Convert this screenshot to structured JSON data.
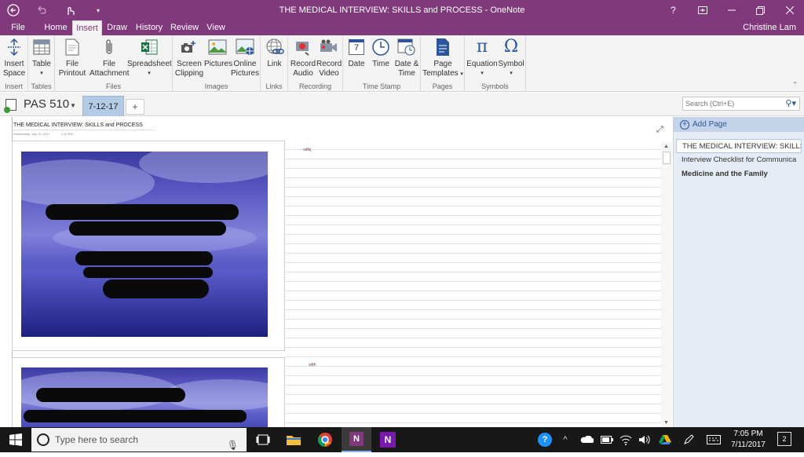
{
  "window": {
    "title": "THE MEDICAL INTERVIEW: SKILLS and PROCESS - OneNote",
    "help": "?",
    "user": "Christine Lam"
  },
  "ribbon_tabs": [
    "File",
    "Home",
    "Insert",
    "Draw",
    "History",
    "Review",
    "View"
  ],
  "active_tab": "Insert",
  "ribbon": {
    "insert_space": [
      "Insert",
      "Space"
    ],
    "table": "Table",
    "file_printout": [
      "File",
      "Printout"
    ],
    "file_attachment": [
      "File",
      "Attachment"
    ],
    "spreadsheet": "Spreadsheet",
    "screen_clipping": [
      "Screen",
      "Clipping"
    ],
    "pictures": "Pictures",
    "online_pictures": [
      "Online",
      "Pictures"
    ],
    "link": "Link",
    "record_audio": [
      "Record",
      "Audio"
    ],
    "record_video": [
      "Record",
      "Video"
    ],
    "date": "Date",
    "time": "Time",
    "date_time": [
      "Date &",
      "Time"
    ],
    "page_templates": [
      "Page",
      "Templates"
    ],
    "equation": "Equation",
    "symbol": "Symbol",
    "date_icon_text": "7",
    "group_labels": {
      "insert": "Insert",
      "tables": "Tables",
      "files": "Files",
      "images": "Images",
      "links": "Links",
      "recording": "Recording",
      "timestamp": "Time Stamp",
      "pages": "Pages",
      "symbols": "Symbols"
    }
  },
  "notebook": {
    "name": "PAS 510",
    "section": "7-12-17",
    "add_section": "+",
    "search_placeholder": "Search (Ctrl+E)"
  },
  "page": {
    "title": "THE MEDICAL INTERVIEW: SKILLS and PROCESS",
    "date": "Wednesday, July 12, 2017",
    "time": "2:14 PM",
    "note1": "sdfsj",
    "note2": "sdfh"
  },
  "pages_pane": {
    "add_page": "Add Page",
    "items": [
      {
        "label": "THE MEDICAL INTERVIEW: SKILLS",
        "selected": true
      },
      {
        "label": "Interview Checklist for Communica"
      },
      {
        "label": "Medicine and the Family",
        "bold": true
      }
    ]
  },
  "taskbar": {
    "search_placeholder": "Type here to search",
    "time": "7:05 PM",
    "date": "7/11/2017",
    "notifications": "2"
  },
  "colors": {
    "onenote_purple": "#80397b",
    "section_tab": "#b3cbe4",
    "pages_pane": "#e6ecf5"
  }
}
